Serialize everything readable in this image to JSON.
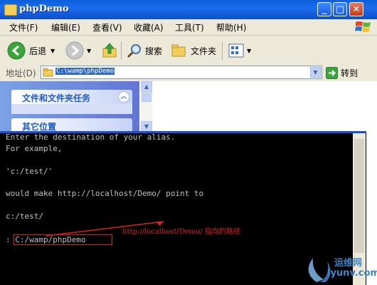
{
  "window": {
    "title": "phpDemo"
  },
  "titlebar": {
    "min": "_",
    "max": "□",
    "close": "✕"
  },
  "menu": [
    "文件(F)",
    "编辑(E)",
    "查看(V)",
    "收藏(A)",
    "工具(T)",
    "帮助(H)"
  ],
  "toolbar": {
    "back": "后退",
    "search": "搜索",
    "folders": "文件夹"
  },
  "address": {
    "label": "地址(D)",
    "value": "C:\\wamp\\phpDemo",
    "go": "转到"
  },
  "tasks": {
    "file_tasks": "文件和文件夹任务",
    "other_places": "其它位置"
  },
  "console": {
    "lines": [
      "Enter the destination of your alias.",
      "For example,",
      "",
      "'c:/test/'",
      "",
      "would make http://localhost/Demo/ point to",
      "",
      "c:/test/",
      "",
      ": C:/wamp/phpDemo"
    ]
  },
  "annotation": "http://localhost/Demo/ 指向的路径",
  "watermark": {
    "cn": "运维网",
    "en": "iyunv.com"
  },
  "colors": {
    "annotation": "#e02020",
    "titlebar": "#0a5fd8",
    "console_bg": "#000000"
  }
}
